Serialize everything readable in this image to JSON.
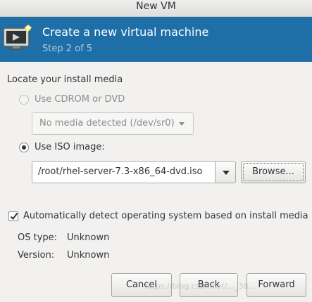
{
  "window": {
    "title": "New VM"
  },
  "banner": {
    "heading": "Create a new virtual machine",
    "step": "Step 2 of 5",
    "icon": "monitor-with-star-icon",
    "color": "#1e6fa8"
  },
  "install_media": {
    "section_label": "Locate your install media",
    "cdrom_option": {
      "label": "Use CDROM or DVD",
      "selected": false,
      "enabled": false
    },
    "cdrom_combo": {
      "value": "No media detected (/dev/sr0)",
      "enabled": false
    },
    "iso_option": {
      "label": "Use ISO image:",
      "selected": true
    },
    "iso_path": "/root/rhel-server-7.3-x86_64-dvd.iso",
    "browse_label": "Browse..."
  },
  "os_detect": {
    "checkbox_label": "Automatically detect operating system based on install media",
    "checked": true,
    "os_type_label": "OS type:",
    "os_type_value": "Unknown",
    "version_label": "Version:",
    "version_value": "Unknown"
  },
  "footer": {
    "cancel_label": "Cancel",
    "back_label": "Back",
    "forward_label": "Forward"
  },
  "watermark": "https://blog.csdn.net/..._38..."
}
